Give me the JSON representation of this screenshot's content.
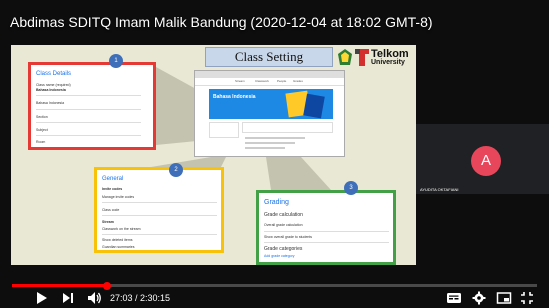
{
  "video": {
    "title": "Abdimas SDITQ Imam Malik Bandung (2020-12-04 at 18:02 GMT-8)"
  },
  "slide": {
    "header": "Class Setting",
    "brand": {
      "name": "Telkom",
      "sub": "University"
    },
    "classroom": {
      "class_name": "Bahasa Indonesia",
      "tabs": [
        "Stream",
        "Classwork",
        "People",
        "Grades"
      ]
    },
    "panels": {
      "details": {
        "badge": "1",
        "title": "Class Details",
        "rows": [
          "Class name (required)",
          "Bahasa Indonesia",
          "Section",
          "Subject",
          "Room"
        ]
      },
      "general": {
        "badge": "2",
        "title": "General",
        "rows": [
          "Invite codes",
          "Manage invite codes",
          "Class code",
          "Stream",
          "Show deleted items",
          "Classwork on the stream",
          "Guardian summaries"
        ]
      },
      "grading": {
        "badge": "3",
        "title": "Grading",
        "rows": [
          "Grade calculation",
          "Overall grade calculation",
          "Show overall grade to students",
          "Grade categories",
          "Add grade category"
        ]
      }
    }
  },
  "participant": {
    "initial": "A",
    "name": "AYUDITA OKTAFIANI"
  },
  "player": {
    "current_time": "27:03",
    "duration": "2:30:15",
    "time_display": "27:03 / 2:30:15",
    "progress_fraction": 0.18,
    "accent_color": "#ff0000"
  }
}
